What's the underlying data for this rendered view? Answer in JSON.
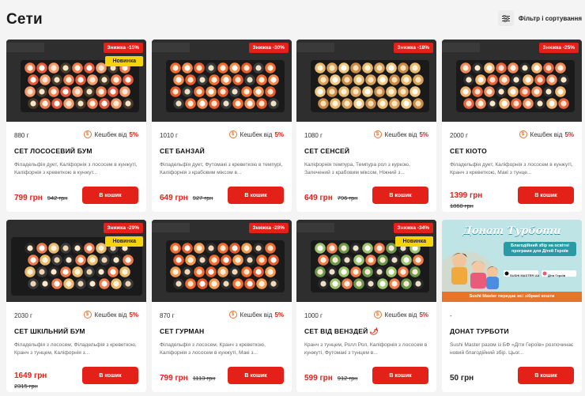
{
  "header": {
    "title": "Сети",
    "filter_label": "Фільтр і сортування"
  },
  "cart_label": "В кошик",
  "cashback_label": "Кешбек від",
  "products": [
    {
      "weight": "880 г",
      "cashback": "5%",
      "name": "СЕТ ЛОСОСЕВИЙ БУМ",
      "desc": "Філадельфія дует, Каліфорнія з лососем в кунжуті, Каліфорнія з креветкою в кунжут...",
      "price": "799 грн",
      "old_price": "942 грн",
      "discount": "Знижка -15%",
      "new": "Новинка"
    },
    {
      "weight": "1010 г",
      "cashback": "5%",
      "name": "СЕТ БАНЗАЙ",
      "desc": "Філадельфія дует, Футомакі з креветкою в темпурі, Каліфорнія з крабовим міксом в...",
      "price": "649 грн",
      "old_price": "927 грн",
      "discount": "Знижка -30%"
    },
    {
      "weight": "1080 г",
      "cashback": "5%",
      "name": "СЕТ СЕНСЕЙ",
      "desc": "Каліфорнія темпура, Темпура рол з куркою, Запечений з крабовим міксом, Ніжний з...",
      "price": "649 грн",
      "old_price": "796 грн",
      "discount": "Знижка -18%"
    },
    {
      "weight": "2000 г",
      "cashback": "5%",
      "name": "СЕТ КІОТО",
      "desc": "Філадельфія дует, Каліфорнія з лососем в кунжуті, Кранч з креветкою, Макі з тунце...",
      "price": "1399 грн",
      "old_price": "1860 грн",
      "discount": "Знижка -25%"
    },
    {
      "weight": "2030 г",
      "cashback": "5%",
      "name": "СЕТ ШКІЛЬНИЙ БУМ",
      "desc": "Філадельфія з лососем, Філадельфія з креветкою, Кранч з тунцем, Каліфорнія з...",
      "price": "1649 грн",
      "old_price": "2315 грн",
      "discount": "Знижка -29%",
      "new": "Новинка"
    },
    {
      "weight": "870 г",
      "cashback": "5%",
      "name": "СЕТ ГУРМАН",
      "desc": "Філадельфія з лососем, Кранч з креветкою, Каліфорнія з лососем в кунжуті, Макі з...",
      "price": "799 грн",
      "old_price": "1113 грн",
      "discount": "Знижка -28%"
    },
    {
      "weight": "1000 г",
      "cashback": "5%",
      "name": "СЕТ ВІД ВЕНЗДЕЙ",
      "chili": "🌶",
      "desc": "Кранч з тунцем, Ролл Рол, Каліфорнія з лососем в кунжуті, Футомакі з тунцем в...",
      "price": "599 грн",
      "old_price": "912 грн",
      "discount": "Знижка -34%",
      "new": "Новинка"
    },
    {
      "weight": "-",
      "name": "ДОНАТ ТУРБОТИ",
      "desc": "Sushi Master разом із БФ «Діти Героїв» розпочинає новий благодійний збір. Цьог...",
      "price": "50 грн"
    }
  ],
  "promo": {
    "title": "Донат Турботи",
    "subtitle": "Благодійний збір на освітні програми для Дітей Героїв",
    "logo1": "SUSHI MASTER UA",
    "logo2": "Діти Героїв",
    "footer": "Sushi Master передає всі зібрані кошти"
  },
  "colors": {
    "accent": "#e32119",
    "badge_new": "#f6d40a",
    "cashback_coin": "#e8732a"
  },
  "icons": {
    "filter": "sliders-icon",
    "cashback": "coin-icon"
  }
}
